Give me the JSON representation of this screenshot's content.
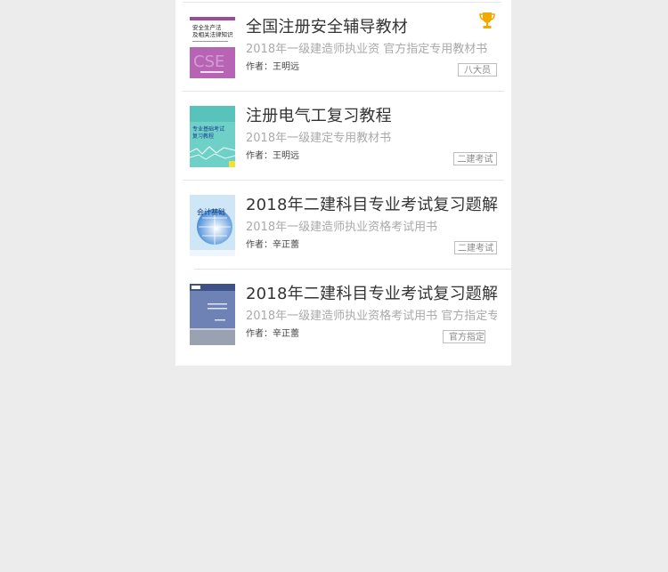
{
  "books": [
    {
      "title": "全国注册安全辅导教材",
      "subtitle": "2018年一级建造师执业资  官方指定专用教材书",
      "author_label": "作者：",
      "author": "王明远",
      "tag": "八大员",
      "has_trophy": true,
      "cover_text": [
        "安全生产法",
        "及相关法律知识"
      ],
      "cover_logo": "CSE"
    },
    {
      "title": "注册电气工复习教程",
      "subtitle": "2018年一级建定专用教材书",
      "author_label": "作者：",
      "author": "王明远",
      "tag": "二建考试",
      "has_trophy": false,
      "cover_text": [
        "专业基础考试",
        "复习教程"
      ]
    },
    {
      "title": "2018年二建科目专业考试复习题解",
      "subtitle": "2018年一级建造师执业资格考试用书",
      "author_label": "作者：",
      "author": "辛正蕾",
      "tag": "二建考试",
      "has_trophy": false,
      "cover_text": [
        "会计基础"
      ]
    },
    {
      "title": "2018年二建科目专业考试复习题解",
      "subtitle": "2018年一级建造师执业资格考试用书  官方指定专",
      "author_label": "作者：",
      "author": "辛正蕾",
      "tag": "官方指定",
      "has_trophy": false,
      "cover_text": []
    }
  ]
}
